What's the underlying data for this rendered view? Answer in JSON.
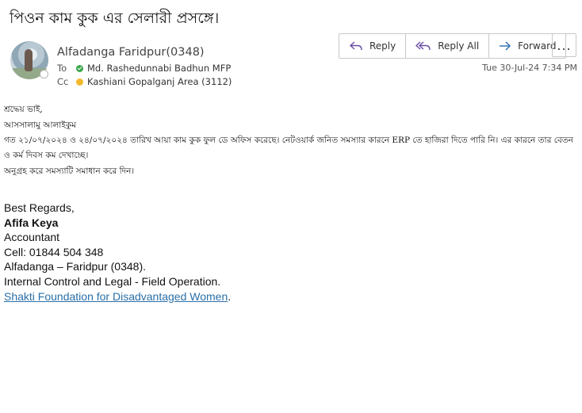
{
  "email": {
    "subject": "পিওন কাম কুক এর সেলারী প্রসঙ্গে।",
    "sender": "Alfadanga Faridpur(0348)",
    "to_label": "To",
    "to": "Md. Rashedunnabi Badhun MFP",
    "cc_label": "Cc",
    "cc": "Kashiani Gopalganj Area (3112)",
    "date": "Tue 30-Jul-24 7:34 PM",
    "presence_colors": {
      "to": "#3aa64a",
      "cc": "#f2b92c"
    }
  },
  "actions": {
    "reply": "Reply",
    "reply_all": "Reply All",
    "forward": "Forward",
    "more": "..."
  },
  "body": {
    "greeting": "শ্রদ্ধেয় ভাই,",
    "salam": "আসসালামু আলাইকুম",
    "para1": "গত ২১/০৭/২০২৪ ও ২৪/০৭/২০২৪ তারিখ আয়া কাম কুক ফুল ডে অফিস করেছে। নেটওয়ার্ক জনিত সমস্যার কারনে ERP তে হাজিরা দিতে পারি নি। এর কারনে তার বেতন ও কর্ম দিবস কম দেখাচ্ছে।",
    "para2": "অনুগ্রহ করে সমস্যাটি সমাধান করে দিন।"
  },
  "signature": {
    "regards": "Best Regards,",
    "name": "Afifa Keya",
    "title": "Accountant",
    "cell": "Cell: 01844 504 348",
    "branch": "Alfadanga – Faridpur (0348).",
    "dept": "Internal Control and Legal - Field Operation.",
    "org_link": "Shakti Foundation for Disadvantaged Women",
    "trailing": "."
  }
}
